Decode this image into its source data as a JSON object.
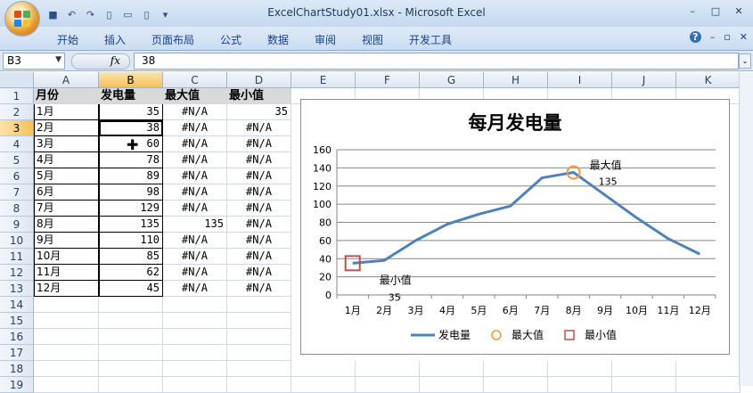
{
  "window": {
    "title": "ExcelChartStudy01.xlsx - Microsoft Excel",
    "controls": [
      "–",
      "□",
      "✕"
    ]
  },
  "ribbon": {
    "tabs": [
      "开始",
      "插入",
      "页面布局",
      "公式",
      "数据",
      "审阅",
      "视图",
      "开发工具"
    ],
    "right_icons": [
      "?",
      "–",
      "▫",
      "✕"
    ]
  },
  "formula_bar": {
    "name_box": "B3",
    "fx": "fx",
    "value": "38"
  },
  "sheet": {
    "columns": [
      "A",
      "B",
      "C",
      "D",
      "E",
      "F",
      "G",
      "H",
      "I",
      "J",
      "K"
    ],
    "selected_column": "B",
    "rows": [
      "1",
      "2",
      "3",
      "4",
      "5",
      "6",
      "7",
      "8",
      "9",
      "10",
      "11",
      "12",
      "13",
      "14",
      "15",
      "16",
      "17",
      "18",
      "19"
    ],
    "selected_row": "3",
    "header": [
      "月份",
      "发电量",
      "最大值",
      "最小值"
    ],
    "data": [
      [
        "1月",
        "35",
        "#N/A",
        "35"
      ],
      [
        "2月",
        "38",
        "#N/A",
        "#N/A"
      ],
      [
        "3月",
        "60",
        "#N/A",
        "#N/A"
      ],
      [
        "4月",
        "78",
        "#N/A",
        "#N/A"
      ],
      [
        "5月",
        "89",
        "#N/A",
        "#N/A"
      ],
      [
        "6月",
        "98",
        "#N/A",
        "#N/A"
      ],
      [
        "7月",
        "129",
        "#N/A",
        "#N/A"
      ],
      [
        "8月",
        "135",
        "135",
        "#N/A"
      ],
      [
        "9月",
        "110",
        "#N/A",
        "#N/A"
      ],
      [
        "10月",
        "85",
        "#N/A",
        "#N/A"
      ],
      [
        "11月",
        "62",
        "#N/A",
        "#N/A"
      ],
      [
        "12月",
        "45",
        "#N/A",
        "#N/A"
      ]
    ]
  },
  "chart_data": {
    "type": "line",
    "title": "每月发电量",
    "categories": [
      "1月",
      "2月",
      "3月",
      "4月",
      "5月",
      "6月",
      "7月",
      "8月",
      "9月",
      "10月",
      "11月",
      "12月"
    ],
    "series": [
      {
        "name": "发电量",
        "values": [
          35,
          38,
          60,
          78,
          89,
          98,
          129,
          135,
          110,
          85,
          62,
          45
        ],
        "color": "#4f81bd"
      },
      {
        "name": "最大值",
        "values": [
          null,
          null,
          null,
          null,
          null,
          null,
          null,
          135,
          null,
          null,
          null,
          null
        ],
        "color": "#f79646",
        "marker": "circle"
      },
      {
        "name": "最小值",
        "values": [
          35,
          null,
          null,
          null,
          null,
          null,
          null,
          null,
          null,
          null,
          null,
          null
        ],
        "color": "#c0504d",
        "marker": "square"
      }
    ],
    "ylim": [
      0,
      160
    ],
    "yticks": [
      "0",
      "20",
      "40",
      "60",
      "80",
      "100",
      "120",
      "140",
      "160"
    ],
    "grid": true,
    "legend": "bottom",
    "annotations": [
      {
        "label": "最大值",
        "value": "135"
      },
      {
        "label": "最小值",
        "value": "35"
      }
    ]
  }
}
